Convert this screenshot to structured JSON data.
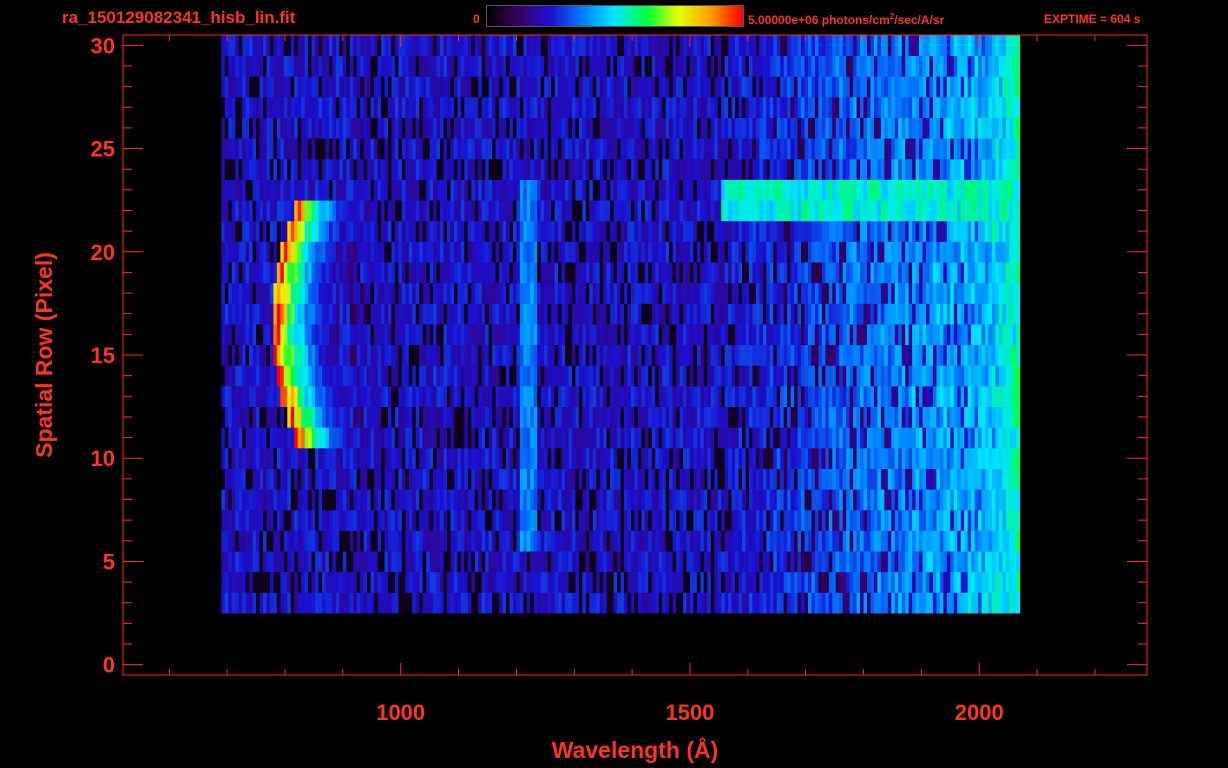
{
  "header": {
    "filename": "ra_150129082341_hisb_lin.fit",
    "colorbar_min": "0",
    "colorbar_max_pre": "5.00000e+06 photons/cm",
    "colorbar_max_sup": "2",
    "colorbar_max_post": "/sec/A/sr",
    "exptime": "EXPTIME = 604 s"
  },
  "colors": {
    "text": "#ff3322",
    "axis": "#ff2a1a",
    "background": "#000000"
  },
  "chart_data": {
    "type": "heatmap",
    "title": "",
    "xlabel": "Wavelength (Å)",
    "ylabel": "Spatial Row (Pixel)",
    "xlim": [
      520,
      2290
    ],
    "ylim": [
      -0.5,
      30.5
    ],
    "x_ticks": [
      1000,
      1500,
      2000
    ],
    "x_tick_labels": [
      "1000",
      "1500",
      "2000"
    ],
    "y_ticks": [
      0,
      5,
      10,
      15,
      20,
      25,
      30
    ],
    "y_tick_labels": [
      "0",
      "5",
      "10",
      "15",
      "20",
      "25",
      "30"
    ],
    "colorbar_range": [
      0,
      5000000
    ],
    "colormap": [
      "#000000",
      "#3a0066",
      "#1a10d0",
      "#0080ff",
      "#00e8ff",
      "#00ff40",
      "#e8ff00",
      "#ffa000",
      "#ff0000"
    ],
    "data_extent": {
      "x": [
        690,
        2070
      ],
      "rows": [
        3,
        30
      ]
    },
    "features": [
      {
        "label": "bright arc emission",
        "x": [
          780,
          940
        ],
        "rows": [
          11,
          22
        ],
        "peak_level": 0.95
      },
      {
        "label": "vertical line",
        "x": [
          1205,
          1230
        ],
        "rows": [
          6,
          23
        ],
        "peak_level": 0.4
      },
      {
        "label": "horizontal band",
        "x": [
          1550,
          2070
        ],
        "rows": [
          22,
          23
        ],
        "peak_level": 0.55
      },
      {
        "label": "long-wavelength rise",
        "x": [
          1900,
          2070
        ],
        "rows": [
          3,
          30
        ],
        "peak_level": 0.6
      }
    ]
  }
}
